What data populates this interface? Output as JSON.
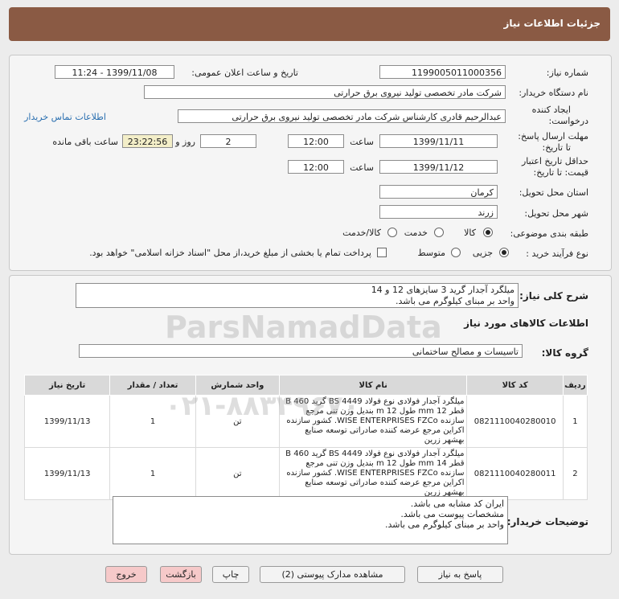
{
  "header": {
    "title": "جزئیات اطلاعات نیاز"
  },
  "form": {
    "need_number_label": "شماره نیاز:",
    "need_number": "1199005011000356",
    "announce_label": "تاریخ و ساعت اعلان عمومی:",
    "announce_value": "1399/11/08 - 11:24",
    "buyer_org_label": "نام دستگاه خریدار:",
    "buyer_org": "شرکت مادر تخصصی تولید نیروی برق حرارتی",
    "creator_label_1": "ایجاد کننده",
    "creator_label_2": "درخواست:",
    "creator": "عبدالرحیم قادری کارشناس شرکت مادر تخصصی تولید نیروی برق حرارتی",
    "contact_link": "اطلاعات تماس خریدار",
    "deadline_label_1": "مهلت ارسال پاسخ:",
    "deadline_label_2": "تا تاریخ:",
    "deadline_date": "1399/11/11",
    "time_label": "ساعت",
    "deadline_time": "12:00",
    "days_count": "2",
    "days_and_label": "روز و",
    "remaining_time": "23:22:56",
    "remaining_label": "ساعت باقی مانده",
    "validity_label_1": "حداقل تاریخ اعتبار",
    "validity_label_2": "قیمت: تا تاریخ:",
    "validity_date": "1399/11/12",
    "validity_time": "12:00",
    "province_label": "استان محل تحویل:",
    "province": "کرمان",
    "city_label": "شهر محل تحویل:",
    "city": "زرند",
    "category_label": "طبقه بندی موضوعی:",
    "category_options": [
      "کالا",
      "خدمت",
      "کالا/خدمت"
    ],
    "category_selected": "کالا",
    "process_label": "نوع فرآیند خرید :",
    "process_options": [
      "جزیی",
      "متوسط"
    ],
    "process_selected": "جزیی",
    "payment_note": "پرداخت تمام یا بخشی از مبلغ خرید،از محل \"اسناد خزانه اسلامی\" خواهد بود."
  },
  "description": {
    "label": "شرح کلی نیاز:",
    "line1": "میلگرد آجدار گرید 3 سایزهای 12 و 14",
    "line2": "واحد بر مبنای کیلوگرم می باشد."
  },
  "goods_section_title": "اطلاعات کالاهای مورد نیاز",
  "goods_group": {
    "label": "گروه کالا:",
    "value": "تاسیسات و مصالح ساختمانی"
  },
  "table": {
    "headers": [
      "ردیف",
      "کد کالا",
      "نام کالا",
      "واحد شمارش",
      "تعداد / مقدار",
      "تاریخ نیاز"
    ],
    "rows": [
      {
        "row": "1",
        "code": "0821110040280010",
        "name": "میلگرد آجدار فولادی نوع فولاد BS 4449 گرید B 460 قطر 12 mm طول 12 m بندیل وزن تنی مرجع سازنده WISE ENTERPRISES FZCo. کشور سازنده اکراین مرجع عرضه کننده صادراتی توسعه صنایع بهشهر زرین",
        "unit": "تن",
        "qty": "1",
        "date": "1399/11/13"
      },
      {
        "row": "2",
        "code": "0821110040280011",
        "name": "میلگرد آجدار فولادی نوع فولاد BS 4449 گرید B 460 قطر 14 mm طول 12 m بندیل وزن تنی مرجع سازنده WISE ENTERPRISES FZCo. کشور سازنده اکراین مرجع عرضه کننده صادراتی توسعه صنایع بهشهر زرین",
        "unit": "تن",
        "qty": "1",
        "date": "1399/11/13"
      }
    ]
  },
  "buyer_notes": {
    "label": "توضیحات خریدار:",
    "line1": "ایران کد مشابه می باشد.",
    "line2": "مشخصات پیوست می باشد.",
    "line3": "واحد بر مبنای کیلوگرم می باشد."
  },
  "buttons": {
    "reply": "پاسخ به نیاز",
    "attachments": "مشاهده مدارک پیوستی (2)",
    "print": "چاپ",
    "back": "بازگشت",
    "exit": "خروج"
  },
  "watermark": {
    "line1": "ParsNamadData",
    "line2": "۰۲۱-۸۸۳۴۹۶۷۰"
  }
}
